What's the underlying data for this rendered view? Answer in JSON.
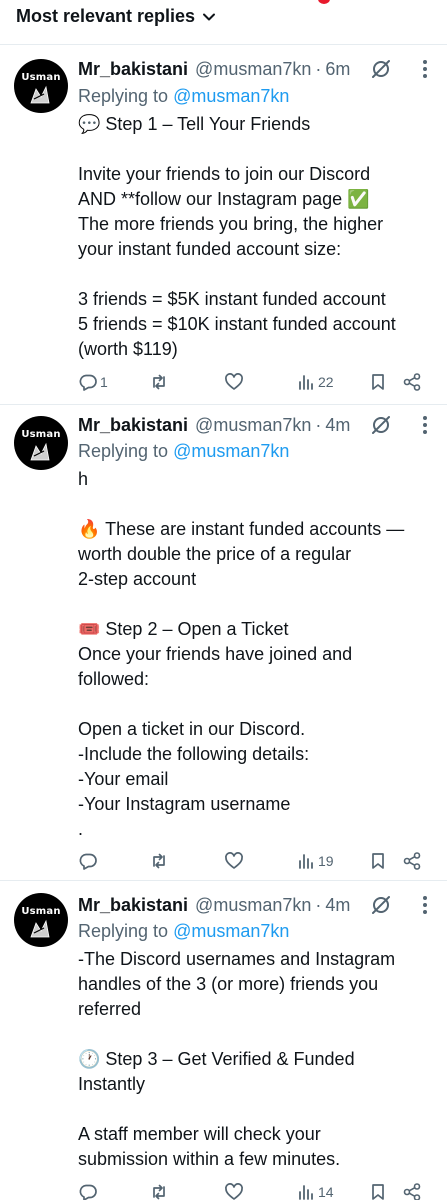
{
  "header": {
    "sort_label": "Most relevant replies"
  },
  "avatar_text": "Usman",
  "posts": [
    {
      "name": "Mr_bakistani",
      "handle": "@musman7kn",
      "dot": "·",
      "time": "6m",
      "reply_prefix": "Replying to",
      "reply_handle": "@musman7kn",
      "lines": [
        "💬 Step 1 – Tell Your Friends",
        "",
        "Invite your friends to join our Discord",
        "AND **follow our Instagram page ✅",
        "The more friends you bring, the higher",
        "your instant funded account size:",
        "",
        "3 friends = $5K instant funded account",
        "5 friends = $10K instant funded account",
        "(worth $119)"
      ],
      "reply_count": "1",
      "views": "22"
    },
    {
      "name": "Mr_bakistani",
      "handle": "@musman7kn",
      "dot": "·",
      "time": "4m",
      "reply_prefix": "Replying to",
      "reply_handle": "@musman7kn",
      "lines": [
        "h",
        "",
        "🔥 These are instant funded accounts —",
        "worth double the price of a regular",
        "2-step account",
        "",
        "🎟️ Step 2 – Open a Ticket",
        "Once your friends have joined and",
        "followed:",
        "",
        "Open a ticket in our Discord.",
        "-Include the following details:",
        "-Your email",
        "-Your Instagram username",
        "."
      ],
      "reply_count": "",
      "views": "19"
    },
    {
      "name": "Mr_bakistani",
      "handle": "@musman7kn",
      "dot": "·",
      "time": "4m",
      "reply_prefix": "Replying to",
      "reply_handle": "@musman7kn",
      "lines": [
        "-The Discord usernames and Instagram",
        "handles of the 3 (or more) friends you",
        "referred",
        "",
        "🕐 Step 3 – Get Verified & Funded",
        "Instantly",
        "",
        "A staff member will check your",
        "submission within a few minutes."
      ],
      "reply_count": "",
      "views": "14"
    }
  ],
  "colors": {
    "link": "#1d9bf0",
    "muted": "#536471",
    "text": "#0f1419"
  }
}
